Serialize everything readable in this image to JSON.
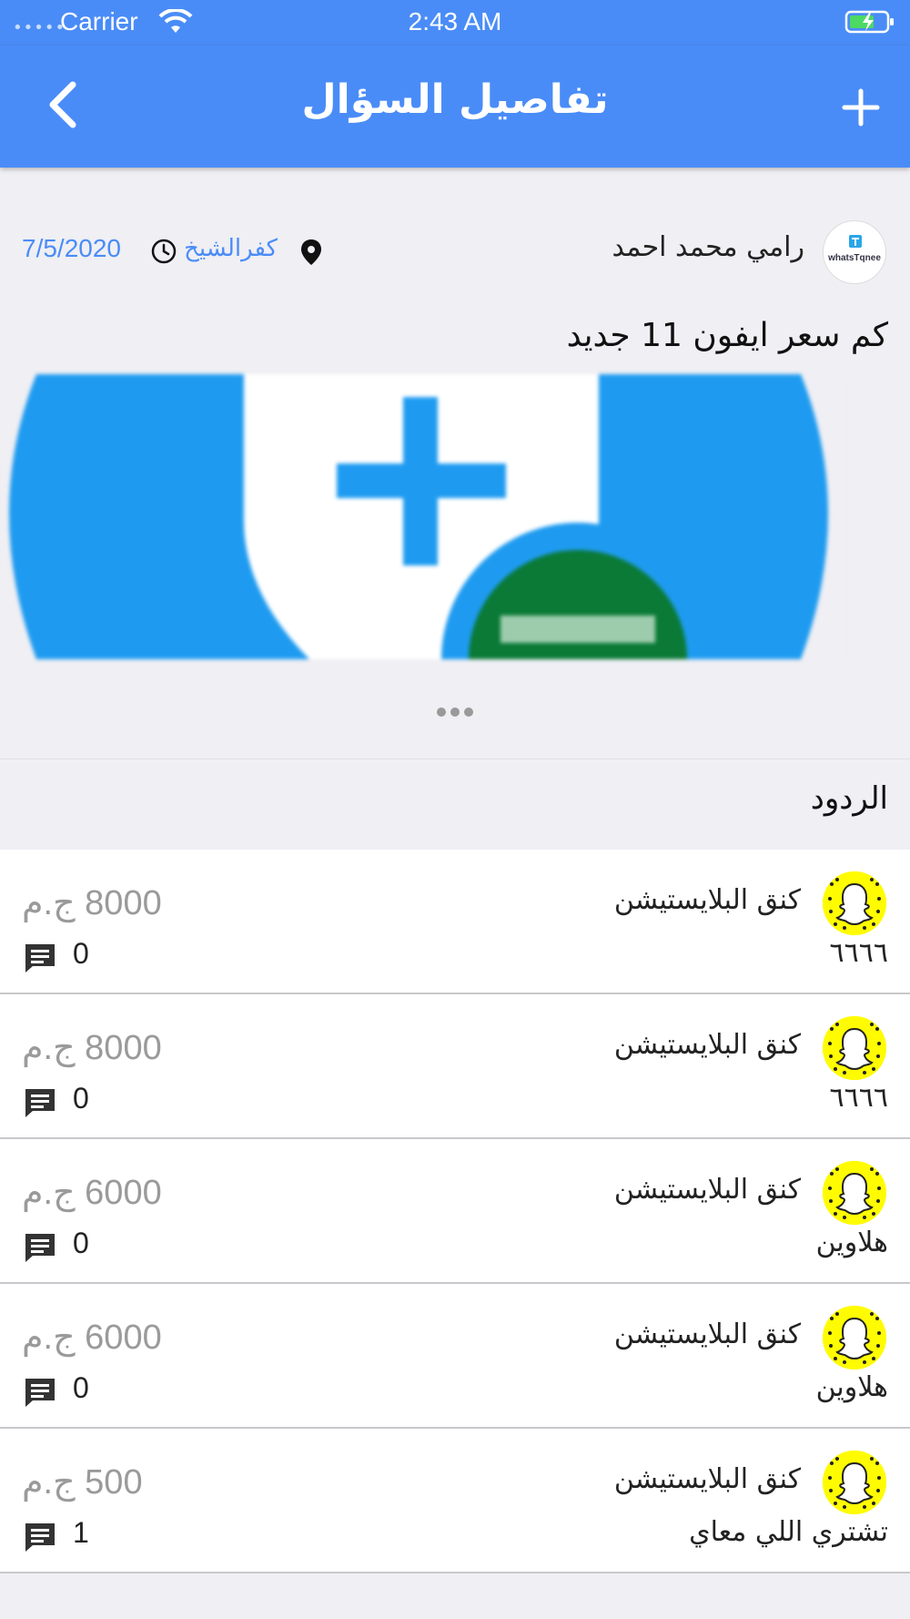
{
  "status_bar": {
    "signal_dots": "•••••",
    "carrier": "Carrier",
    "time": "2:43 AM",
    "battery_state": "charging"
  },
  "nav": {
    "title": "تفاصيل السؤال",
    "back_icon": "chevron-left-icon",
    "add_icon": "plus-icon"
  },
  "post": {
    "author_name": "رامي محمد احمد",
    "avatar_label": "whatsTqnee",
    "location": "كفرالشيخ",
    "date": "7/5/2020",
    "question": "كم سعر ايفون 11 جديد"
  },
  "replies_header": "الردود",
  "replies": [
    {
      "name": "كنق البلايستيشن",
      "text": "٦٦٦٦",
      "price": "8000 ج.م",
      "comments": "0"
    },
    {
      "name": "كنق البلايستيشن",
      "text": "٦٦٦٦",
      "price": "8000 ج.م",
      "comments": "0"
    },
    {
      "name": "كنق البلايستيشن",
      "text": "هلاوين",
      "price": "6000 ج.م",
      "comments": "0"
    },
    {
      "name": "كنق البلايستيشن",
      "text": "هلاوين",
      "price": "6000 ج.م",
      "comments": "0"
    },
    {
      "name": "كنق البلايستيشن",
      "text": "تشتري اللي معاي",
      "price": "500 ج.م",
      "comments": "1"
    }
  ],
  "colors": {
    "primary": "#4a8cf7",
    "background": "#efeff4",
    "price_gray": "#9a9a9a",
    "snap_yellow": "#fffc00",
    "image_blue": "#1e9bf0",
    "flag_green": "#0a7a36"
  }
}
